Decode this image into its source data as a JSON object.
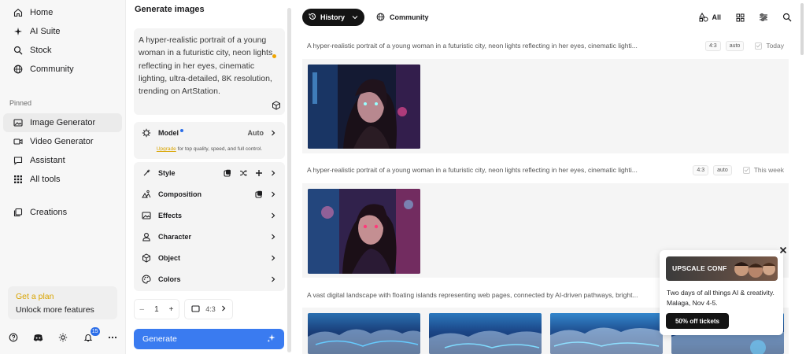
{
  "sidebar": {
    "nav": [
      {
        "label": "Home",
        "icon": "home-icon"
      },
      {
        "label": "AI Suite",
        "icon": "sparkles-icon"
      },
      {
        "label": "Stock",
        "icon": "search-icon"
      },
      {
        "label": "Community",
        "icon": "globe-icon"
      }
    ],
    "pinned_label": "Pinned",
    "pinned": [
      {
        "label": "Image Generator",
        "icon": "image-icon"
      },
      {
        "label": "Video Generator",
        "icon": "video-icon"
      },
      {
        "label": "Assistant",
        "icon": "chat-icon"
      },
      {
        "label": "All tools",
        "icon": "grid-icon"
      }
    ],
    "creations": {
      "label": "Creations",
      "icon": "layers-icon"
    },
    "plan": {
      "get": "Get a plan",
      "unlock": "Unlock more features"
    },
    "notification_count": "15"
  },
  "panel": {
    "title": "Generate images",
    "prompt": "A hyper-realistic portrait of a young woman in a futuristic city, neon lights reflecting in her eyes, cinematic lighting, ultra-detailed, 8K resolution, trending on ArtStation.",
    "model": {
      "label": "Model",
      "value": "Auto"
    },
    "upgrade": {
      "link": "Upgrade",
      "text": " for top quality, speed, and full control."
    },
    "options": [
      "Style",
      "Composition",
      "Effects",
      "Character",
      "Object",
      "Colors"
    ],
    "count": {
      "minus": "–",
      "value": "1",
      "plus": "+"
    },
    "ratio": "4:3",
    "generate_label": "Generate"
  },
  "topbar": {
    "history": "History",
    "community": "Community",
    "all": "All"
  },
  "groups": [
    {
      "prompt": "A hyper-realistic portrait of a young woman in a futuristic city, neon lights reflecting in her eyes, cinematic lighti...",
      "ratio": "4:3",
      "mode": "auto",
      "when": "Today"
    },
    {
      "prompt": "A hyper-realistic portrait of a young woman in a futuristic city, neon lights reflecting in her eyes, cinematic lighti...",
      "ratio": "4:3",
      "mode": "auto",
      "when": "This week"
    },
    {
      "prompt": "A vast digital landscape with floating islands representing web pages, connected by AI-driven pathways, bright..."
    }
  ],
  "ad": {
    "banner": "UPSCALE CONF",
    "text": "Two days of all things AI & creativity. Malaga, Nov 4-5.",
    "button": "50% off tickets"
  },
  "colors": {
    "accent": "#3a7bf0",
    "gold": "#d9a400",
    "dark": "#141414"
  }
}
